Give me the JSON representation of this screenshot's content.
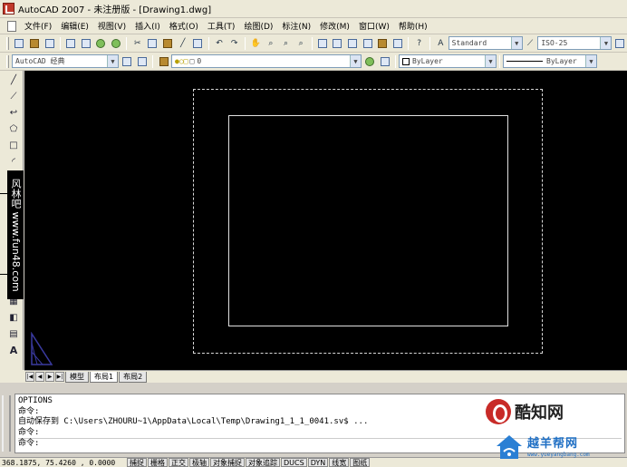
{
  "window": {
    "title": "AutoCAD 2007 - 未注册版 - [Drawing1.dwg]"
  },
  "menu": [
    "文件(F)",
    "编辑(E)",
    "视图(V)",
    "插入(I)",
    "格式(O)",
    "工具(T)",
    "绘图(D)",
    "标注(N)",
    "修改(M)",
    "窗口(W)",
    "帮助(H)"
  ],
  "toolbar": {
    "text_style": "Standard",
    "dim_style": "ISO-25",
    "workspace": "AutoCAD 经典",
    "layer": "0",
    "color": "ByLayer",
    "linetype": "ByLayer"
  },
  "watermark_text": "风林吧 www.fun48.com",
  "layout_tabs": [
    "模型",
    "布局1",
    "布局2"
  ],
  "active_layout": "布局1",
  "command_lines": [
    "OPTIONS",
    "命令:",
    "自动保存到 C:\\Users\\ZHOURU~1\\AppData\\Local\\Temp\\Drawing1_1_1_0041.sv$ ...",
    "命令:",
    "命令:"
  ],
  "status": {
    "coords": "368.1875, 75.4260 , 0.0000",
    "buttons": [
      "捕捉",
      "栅格",
      "正交",
      "极轴",
      "对象捕捉",
      "对象追踪",
      "DUCS",
      "DYN",
      "线宽",
      "图纸"
    ]
  },
  "logos": {
    "logo1_text": "酷知网",
    "logo2_text": "越羊帮网",
    "logo2_url": "www.yueyangbang.com"
  },
  "colors": {
    "canvas": "#000000",
    "chrome": "#ece9d8",
    "accent_red": "#c82b28",
    "accent_blue": "#1f6fc4"
  }
}
